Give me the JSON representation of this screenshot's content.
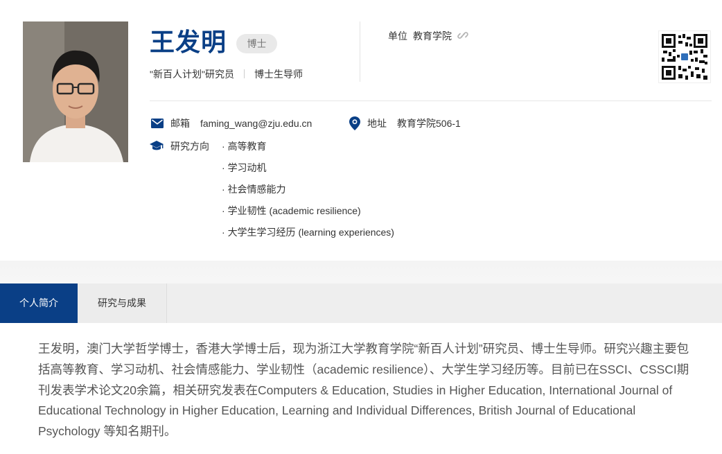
{
  "profile": {
    "name": "王发明",
    "degree": "博士",
    "titles": [
      "\"新百人计划\"研究员",
      "博士生导师"
    ],
    "unit_label": "单位",
    "unit_value": "教育学院",
    "email_label": "邮箱",
    "email_value": "faming_wang@zju.edu.cn",
    "address_label": "地址",
    "address_value": "教育学院506-1",
    "research_label": "研究方向",
    "research_items": [
      "高等教育",
      "学习动机",
      "社会情感能力",
      "学业韧性 (academic resilience)",
      "大学生学习经历 (learning experiences)"
    ]
  },
  "tabs": [
    {
      "label": "个人简介",
      "active": true
    },
    {
      "label": "研究与成果",
      "active": false
    }
  ],
  "bio": "王发明，澳门大学哲学博士，香港大学博士后，现为浙江大学教育学院“新百人计划”研究员、博士生导师。研究兴趣主要包括高等教育、学习动机、社会情感能力、学业韧性（academic resilience）、大学生学习经历等。目前已在SSCI、CSSCI期刊发表学术论文20余篇，相关研究发表在Computers & Education, Studies in Higher Education, International Journal of Educational Technology in Higher Education, Learning and Individual Differences, British Journal of Educational Psychology 等知名期刊。",
  "colors": {
    "brand": "#0a3f86",
    "tab_bg": "#eeeeee",
    "badge_bg": "#e9e9e9"
  },
  "icons": {
    "email": "mail-icon",
    "address": "location-pin-icon",
    "research": "graduation-cap-icon",
    "unit_link": "link-icon",
    "qr": "qr-code-icon"
  }
}
